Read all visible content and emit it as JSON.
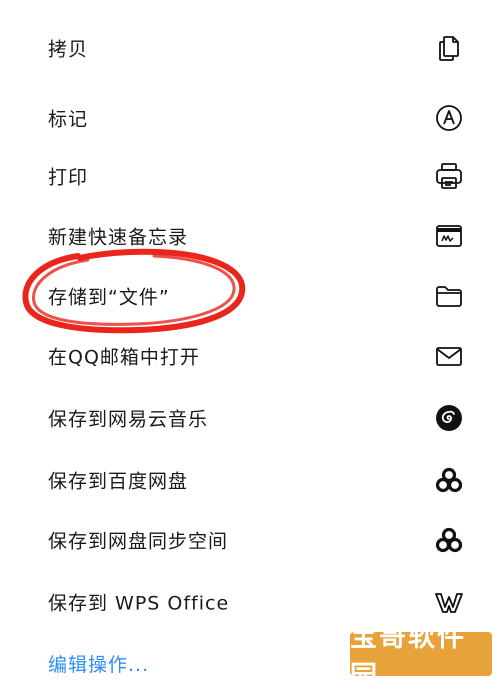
{
  "actions": [
    {
      "label": "拷贝",
      "icon": "copy-icon"
    },
    {
      "label": "标记",
      "icon": "markup-icon"
    },
    {
      "label": "打印",
      "icon": "print-icon"
    },
    {
      "label": "新建快速备忘录",
      "icon": "quick-note-icon"
    },
    {
      "label": "存储到“文件”",
      "icon": "folder-icon"
    },
    {
      "label": "在QQ邮箱中打开",
      "icon": "mail-icon"
    },
    {
      "label": "保存到网易云音乐",
      "icon": "netease-music-icon"
    },
    {
      "label": "保存到百度网盘",
      "icon": "baidu-netdisk-icon"
    },
    {
      "label": "保存到网盘同步空间",
      "icon": "netdisk-sync-icon"
    },
    {
      "label": "保存到 WPS Office",
      "icon": "wps-office-icon"
    }
  ],
  "edit_actions_label": "编辑操作...",
  "watermark_text": "宝哥软件园",
  "colors": {
    "text": "#1a1a1a",
    "link": "#2f8ff0",
    "highlight": "#e8261c",
    "watermark": "#e8a23a"
  }
}
